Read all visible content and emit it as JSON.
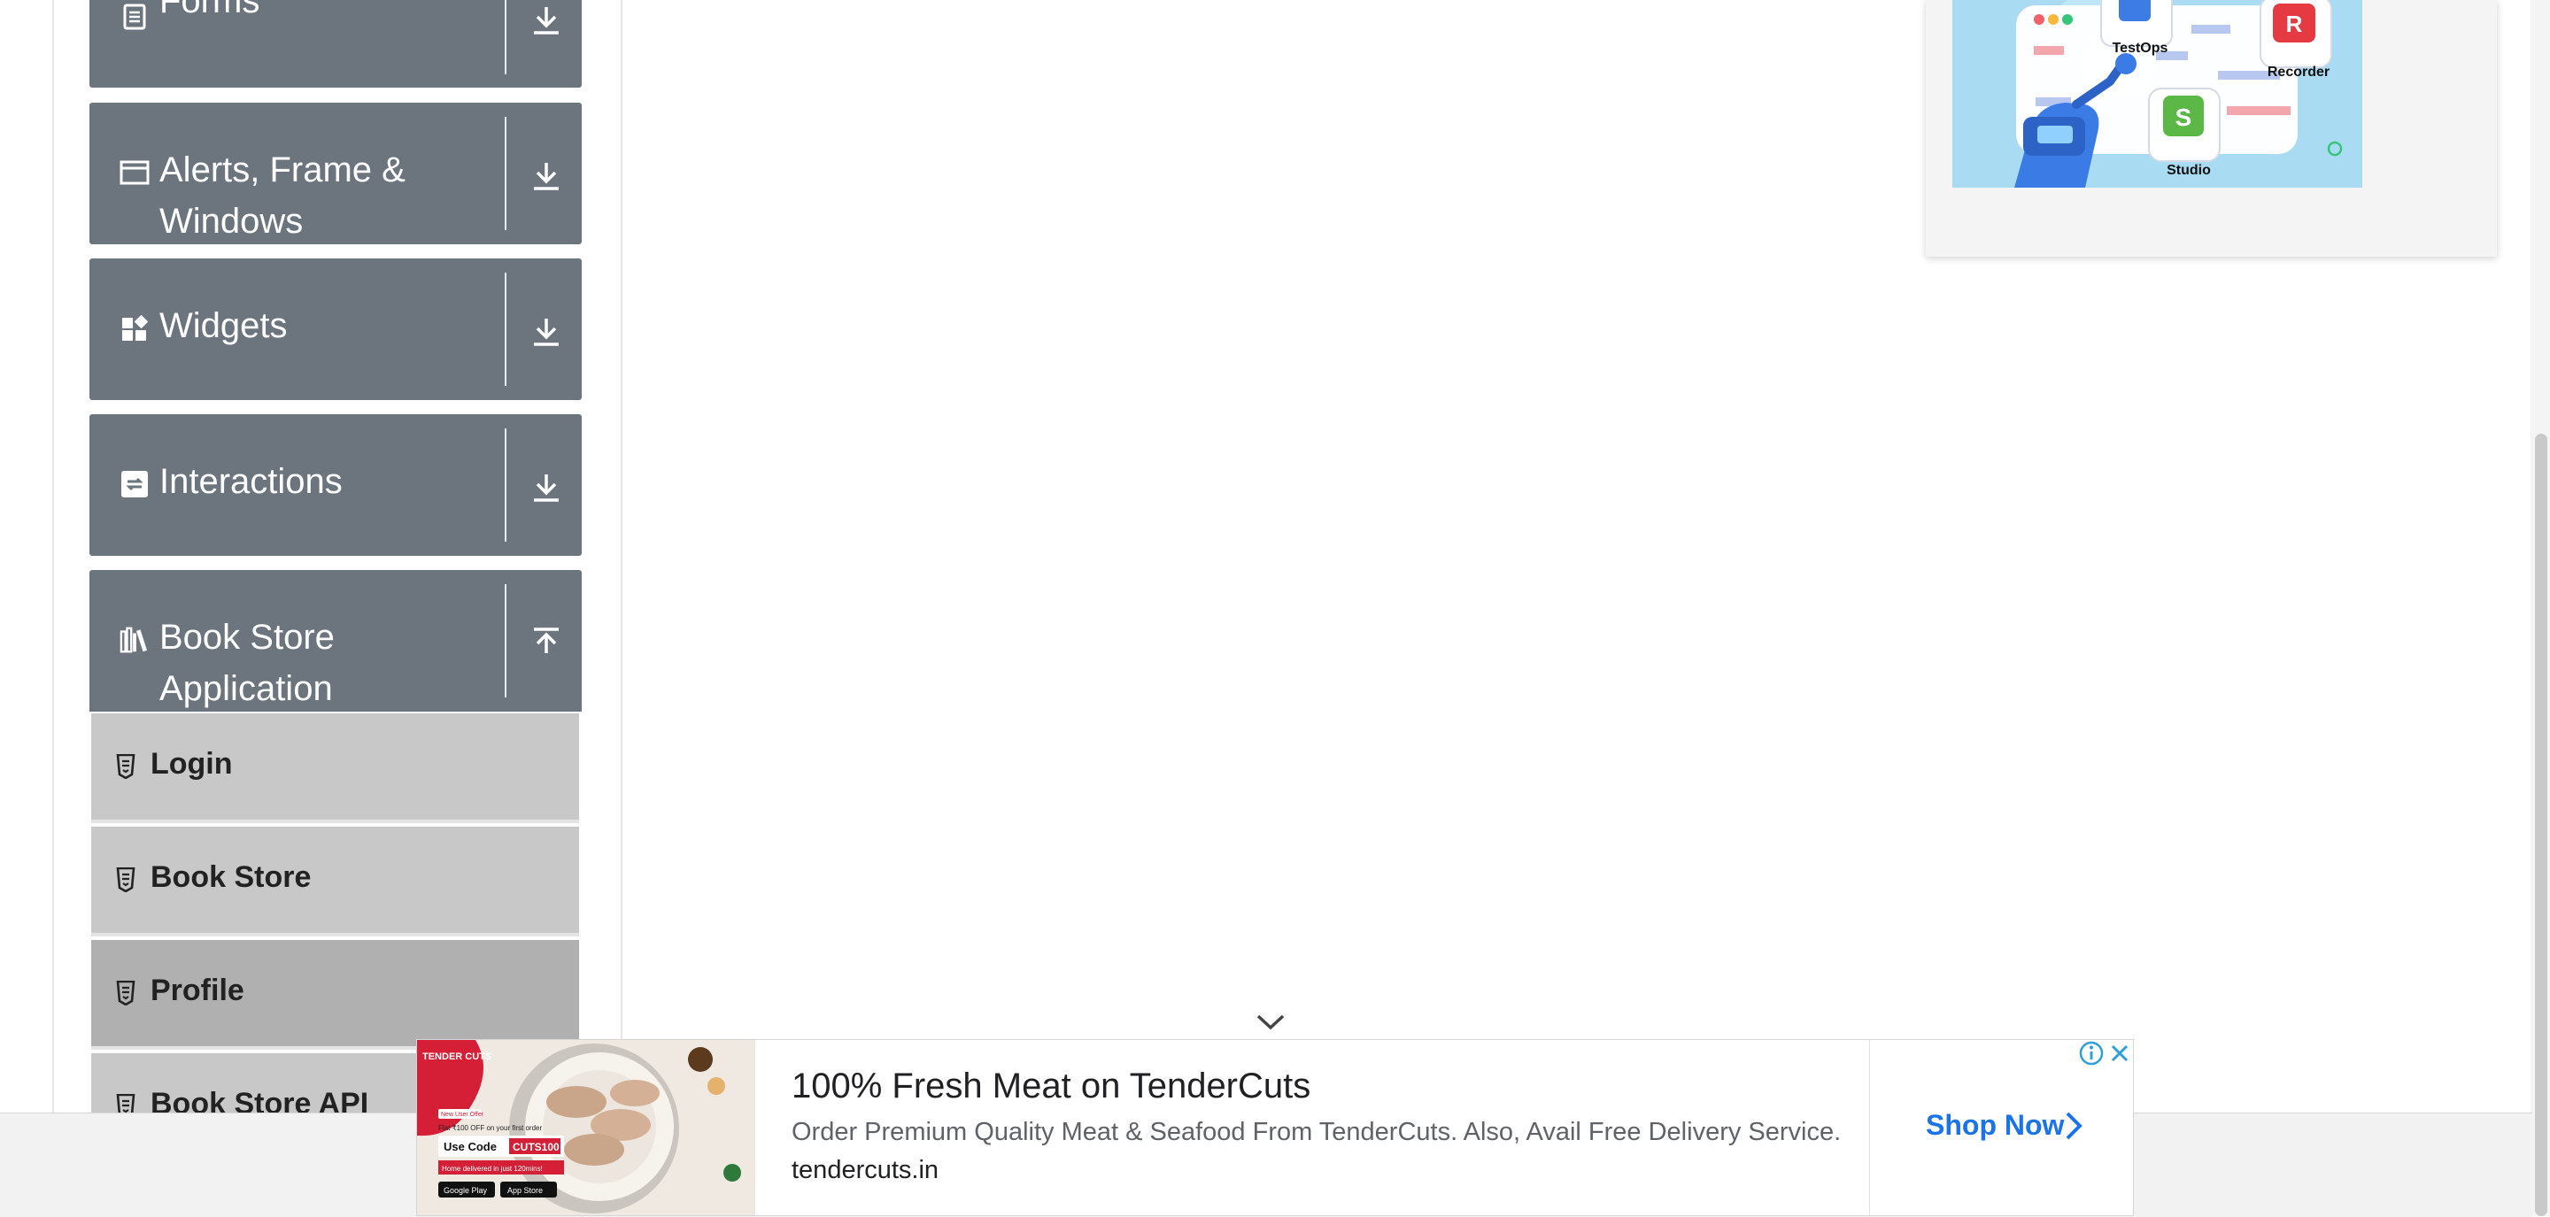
{
  "sidebar": {
    "groups": [
      {
        "label": "Forms",
        "icon": "document-icon",
        "arrow": "download-arrow-icon"
      },
      {
        "label": "Alerts, Frame & Windows",
        "label_line1": "Alerts, Frame &",
        "label_line2": "Windows",
        "icon": "window-icon",
        "arrow": "download-arrow-icon"
      },
      {
        "label": "Widgets",
        "icon": "widgets-icon",
        "arrow": "download-arrow-icon"
      },
      {
        "label": "Interactions",
        "icon": "interactions-icon",
        "arrow": "download-arrow-icon"
      },
      {
        "label": "Book Store Application",
        "label_line1": "Book Store",
        "label_line2": "Application",
        "icon": "books-icon",
        "arrow": "upload-arrow-icon",
        "expanded": true
      }
    ],
    "book_store_items": [
      {
        "label": "Login",
        "active": false
      },
      {
        "label": "Book Store",
        "active": false
      },
      {
        "label": "Profile",
        "active": true
      },
      {
        "label": "Book Store API",
        "active": false
      }
    ]
  },
  "promo": {
    "labels": {
      "testops": "TestOps",
      "recorder": "Recorder",
      "studio": "Studio"
    }
  },
  "ad": {
    "title": "100% Fresh Meat on TenderCuts",
    "description": "Order Premium Quality Meat & Seafood From TenderCuts. Also, Avail Free Delivery Service.",
    "domain": "tendercuts.in",
    "cta": "Shop Now",
    "image_text": {
      "brand": "TENDER CUTS",
      "offer_badge": "New User Offer",
      "offer_line": "Flat ₹100 OFF on your first order",
      "code_label": "Use Code",
      "code": "CUTS100",
      "delivery": "Home delivered in just 120mins!",
      "store_google": "Google Play",
      "store_apple": "App Store"
    }
  },
  "colors": {
    "group_bg": "#6c757d",
    "subitem_bg": "#c8c8c8",
    "subitem_active_bg": "#b0b0b0",
    "ad_cta": "#1a73e8"
  }
}
